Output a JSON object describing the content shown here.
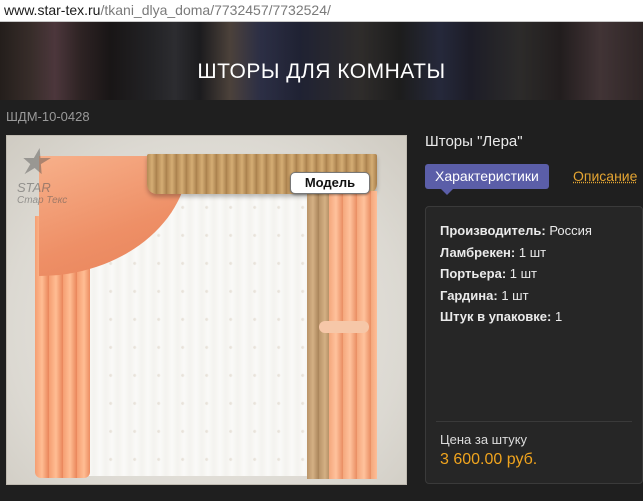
{
  "browser": {
    "url_host": "www.star-tex.ru",
    "url_path": "/tkani_dlya_doma/7732457/7732524/"
  },
  "banner": {
    "title": "ШТОРЫ ДЛЯ КОМНАТЫ"
  },
  "product": {
    "sku": "ШДМ-10-0428",
    "title": "Шторы \"Лера\"",
    "image": {
      "model_badge": "Модель",
      "watermark_star": "STAR",
      "watermark_text": "Стар Текс"
    },
    "tabs": {
      "characteristics": "Характеристики",
      "description": "Описание"
    },
    "specs": [
      {
        "key": "Производитель:",
        "value": "Россия"
      },
      {
        "key": "Ламбрекен:",
        "value": "1 шт"
      },
      {
        "key": "Портьера:",
        "value": "1 шт"
      },
      {
        "key": "Гардина:",
        "value": "1 шт"
      },
      {
        "key": "Штук в упаковке:",
        "value": "1"
      }
    ],
    "price_label": "Цена за штуку",
    "price_value": "3 600.00 руб."
  },
  "colors": {
    "accent_tab": "#5b5ea8",
    "price": "#f0a41e",
    "link": "#e5a532",
    "background": "#1f1f1f"
  }
}
